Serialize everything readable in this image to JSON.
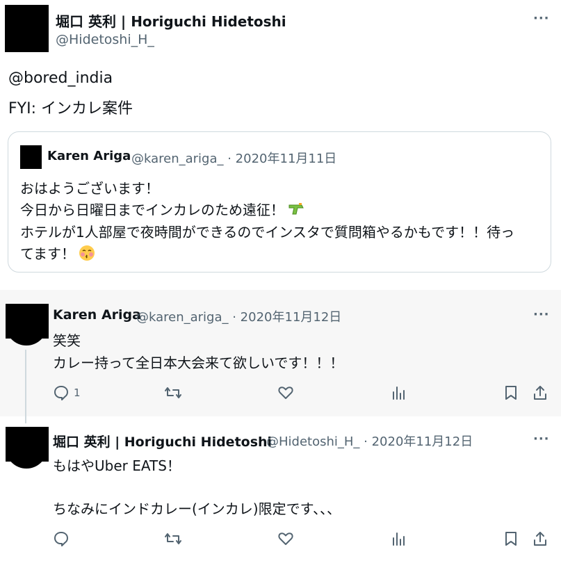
{
  "main_tweet": {
    "name": "堀口 英利 | Horiguchi Hidetoshi",
    "handle": "@Hidetoshi_H_",
    "lines": [
      "@bored_india",
      "FYI: インカレ案件"
    ]
  },
  "quoted": {
    "name": "Karen Ariga",
    "handle_date": "@karen_ariga_ · 2020年11月11日",
    "lines": [
      "おはようございます！",
      "今日から日曜日までインカレのため遠征！",
      "ホテルが1人部屋で夜時間ができるのでインスタで質問箱やるかもです！！待っ",
      "てます！"
    ],
    "emojis": [
      "water-pistol",
      "kissing-face"
    ]
  },
  "reply1": {
    "name": "Karen Ariga",
    "handle_date": "@karen_ariga_ · 2020年11月12日",
    "lines": [
      "笑笑",
      "カレー持って全日本大会来て欲しいです！！！"
    ],
    "reply_count": "1"
  },
  "reply2": {
    "name": "堀口 英利 | Horiguchi Hidetoshi",
    "handle_date": "@Hidetoshi_H_ · 2020年11月12日",
    "lines": [
      "もはやUber EATS！",
      "",
      "ちなみにインドカレー(インカレ)限定です、、、"
    ],
    "reply_count": ""
  },
  "more_label": "···",
  "colors": {
    "text": "#0f1419",
    "secondary": "#536471",
    "highlight_bg": "#f7f7f7",
    "border": "#cfd9de"
  }
}
